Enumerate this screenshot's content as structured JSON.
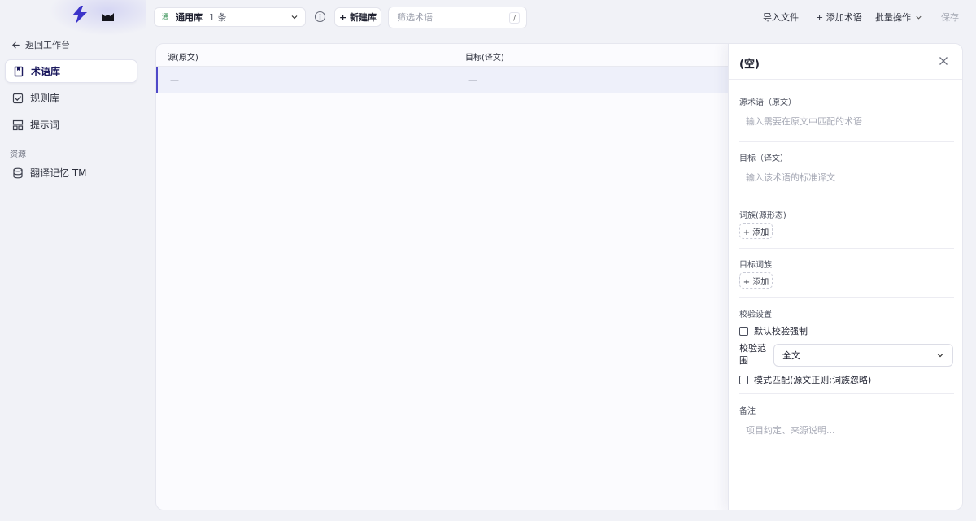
{
  "sidebar": {
    "back_label": "返回工作台",
    "items": [
      {
        "label": "术语库",
        "icon": "book-icon",
        "active": true
      },
      {
        "label": "规则库",
        "icon": "checkbox-icon",
        "active": false
      },
      {
        "label": "提示词",
        "icon": "template-icon",
        "active": false
      }
    ],
    "section_label": "资源",
    "resource_items": [
      {
        "label": "翻译记忆 TM",
        "icon": "database-icon"
      }
    ]
  },
  "topbar": {
    "library": {
      "badge": "通",
      "name": "通用库",
      "count": "1 条"
    },
    "new_library_label": "+ 新建库",
    "filter_placeholder": "筛选术语",
    "filter_shortcut": "/",
    "import_label": "导入文件",
    "add_term_label": "+ 添加术语",
    "batch_label": "批量操作",
    "save_label": "保存"
  },
  "table": {
    "columns": [
      "源(原文)",
      "目标(译文)"
    ],
    "rows": [
      {
        "source": "—",
        "target": "—"
      }
    ]
  },
  "panel": {
    "title": "(空)",
    "source_label": "源术语（原文）",
    "source_placeholder": "输入需要在原文中匹配的术语",
    "target_label": "目标（译文）",
    "target_placeholder": "输入该术语的标准译文",
    "source_family_label": "词族(源形态)",
    "target_family_label": "目标词族",
    "add_label": "+ 添加",
    "validation_label": "校验设置",
    "default_enforce_label": "默认校验强制",
    "scope_label": "校验范围",
    "scope_value": "全文",
    "pattern_match_label": "模式匹配(源文正则;词族忽略)",
    "notes_label": "备注",
    "notes_placeholder": "项目约定、来源说明..."
  },
  "colors": {
    "accent": "#4f49c8",
    "active_nav_text": "#1c1a5e",
    "row_highlight": "#eef0fa",
    "background": "#f1f2f7"
  }
}
